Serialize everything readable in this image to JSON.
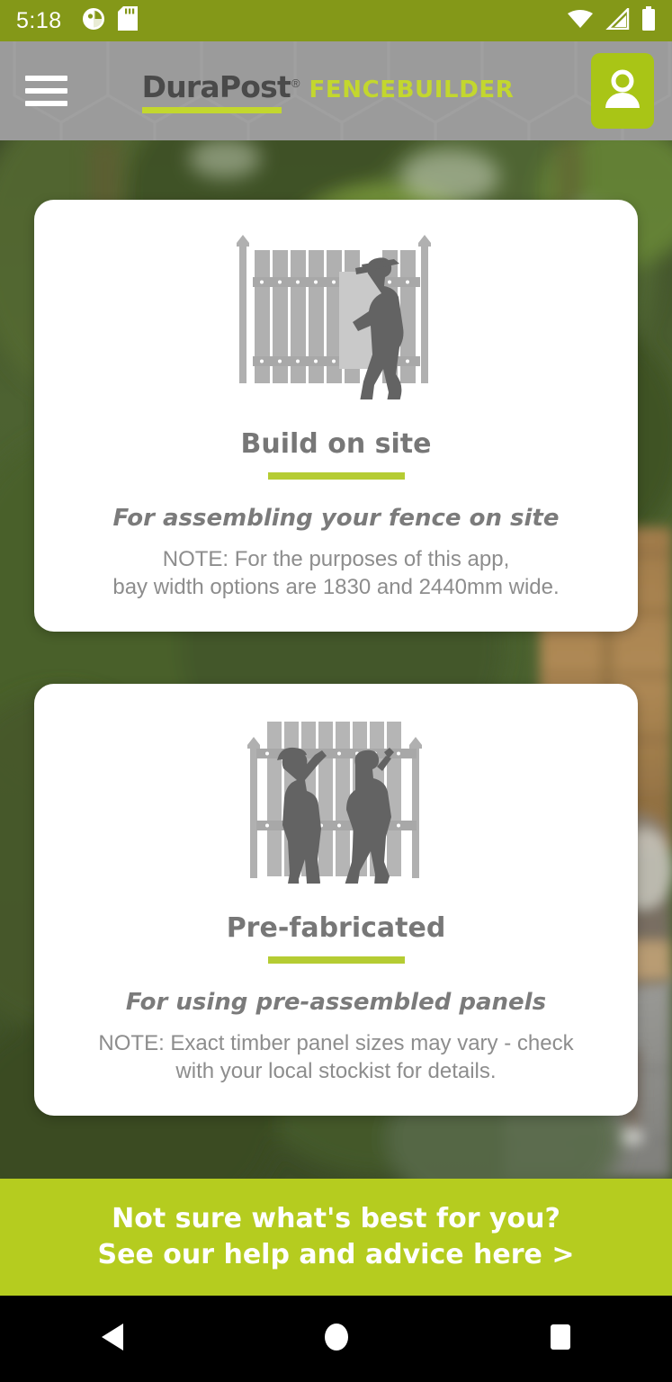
{
  "statusbar": {
    "time": "5:18",
    "icons": [
      "app-notification-icon",
      "sd-card-icon",
      "wifi-icon",
      "cellular-signal-icon",
      "battery-icon"
    ]
  },
  "header": {
    "menu_icon": "hamburger-menu-icon",
    "brand_primary": "DuraPost",
    "brand_registered": "®",
    "brand_secondary": "FENCEBUILDER",
    "account_icon": "account-person-icon"
  },
  "cards": [
    {
      "id": "build-on-site",
      "illustration": "worker-building-fence-illustration",
      "title": "Build on site",
      "subtitle": "For assembling your fence on site",
      "note_line1": "NOTE: For the purposes of this app,",
      "note_line2": "bay width options are 1830 and 2440mm wide."
    },
    {
      "id": "pre-fabricated",
      "illustration": "two-workers-panel-illustration",
      "title": "Pre-fabricated",
      "subtitle": "For using pre-assembled panels",
      "note_line1": "NOTE: Exact timber panel sizes may vary - check",
      "note_line2": "with your local stockist for details."
    }
  ],
  "banner": {
    "line1": "Not sure what's best for you?",
    "line2": "See our help and advice here >"
  },
  "navbar": {
    "back": "back-triangle-icon",
    "home": "home-circle-icon",
    "recents": "recents-square-icon"
  },
  "colors": {
    "status_green": "#849818",
    "banner_green": "#b5cc1f",
    "accent_green": "#b5cc33",
    "brand_green": "#c3d72e",
    "header_gray": "#9b9b9b",
    "title_gray": "#777777",
    "card_white": "#ffffff"
  }
}
